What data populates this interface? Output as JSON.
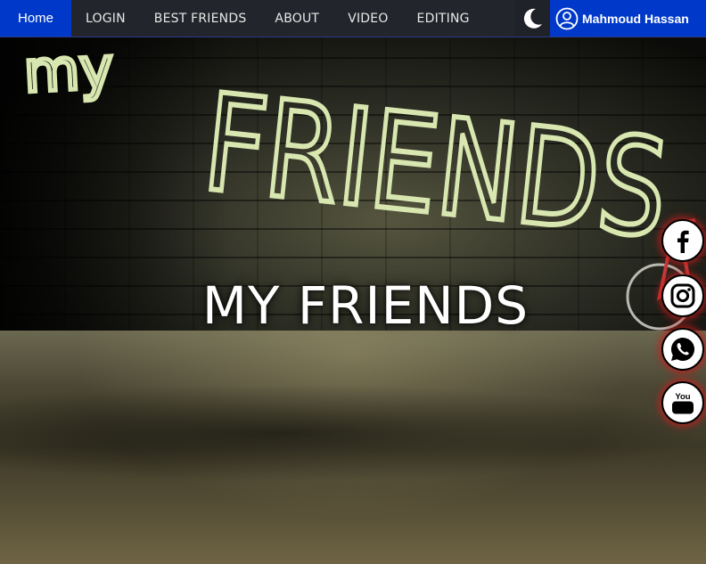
{
  "nav": {
    "home": "Home",
    "items": [
      "LOGIN",
      "BEST FRIENDS",
      "ABOUT",
      "VIDEO",
      "EDITING"
    ],
    "theme_icon": "moon-icon",
    "user_name": "Mahmoud Hassan",
    "user_icon": "user-circle-icon"
  },
  "hero": {
    "title": "MY FRIENDS",
    "graffiti_small": "my",
    "graffiti_big": "FRIENDS"
  },
  "social": [
    {
      "name": "facebook",
      "icon": "facebook-icon"
    },
    {
      "name": "instagram",
      "icon": "instagram-icon"
    },
    {
      "name": "whatsapp",
      "icon": "whatsapp-icon"
    },
    {
      "name": "youtube",
      "icon": "youtube-icon",
      "label": "You Tube"
    }
  ],
  "colors": {
    "nav_bg": "#22252b",
    "accent_blue": "#0039c9",
    "graffiti": "#d8e6b0",
    "social_glow": "#c81e1e"
  }
}
